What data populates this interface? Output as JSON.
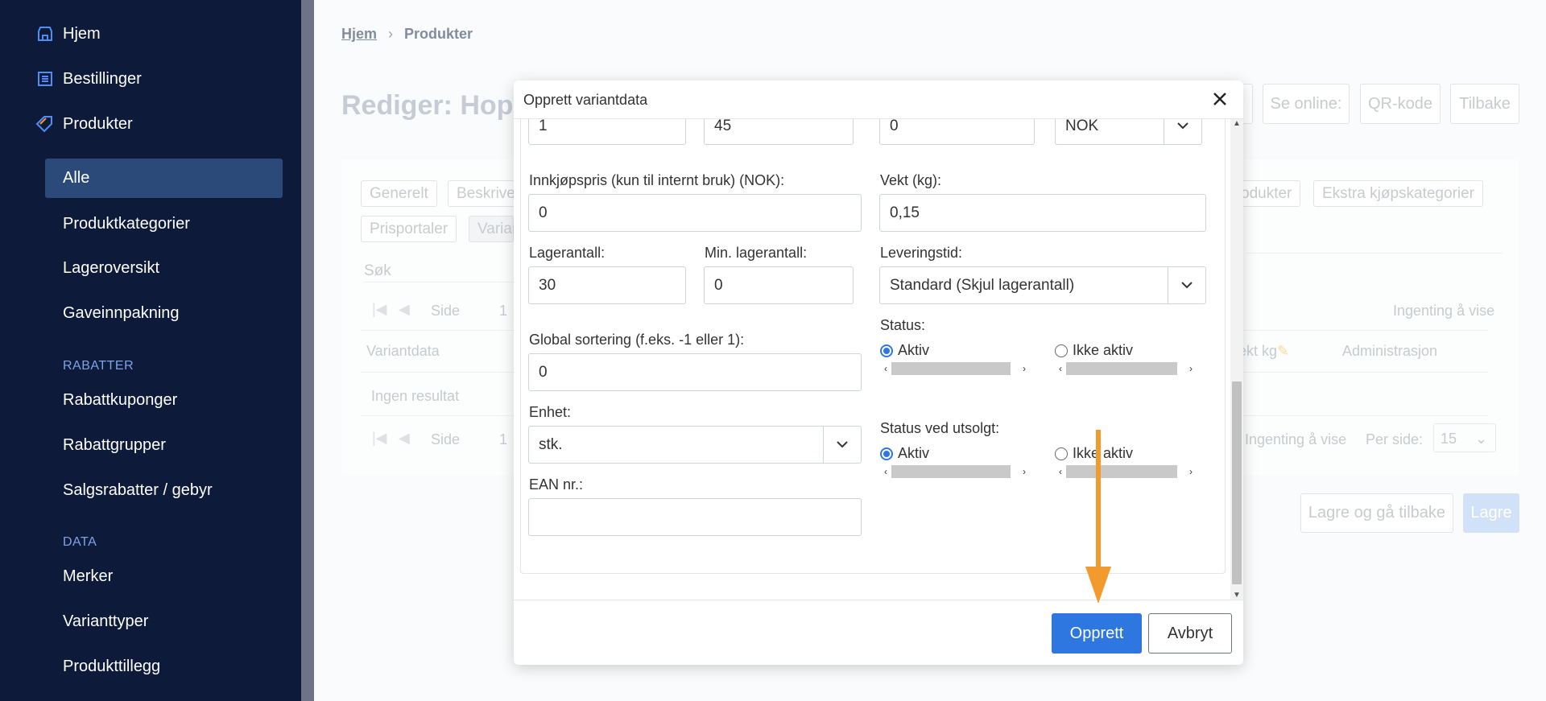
{
  "sidebar": {
    "top_items": [
      {
        "label": "Hjem",
        "icon": "store-icon"
      },
      {
        "label": "Bestillinger",
        "icon": "list-icon"
      },
      {
        "label": "Produkter",
        "icon": "tag-icon"
      }
    ],
    "produkter_sub": [
      "Alle",
      "Produktkategorier",
      "Lageroversikt",
      "Gaveinnpakning"
    ],
    "rabatter_header": "RABATTER",
    "rabatter_items": [
      "Rabattkuponger",
      "Rabattgrupper",
      "Salgsrabatter / gebyr"
    ],
    "data_header": "DATA",
    "data_items": [
      "Merker",
      "Varianttyper",
      "Produkttillegg"
    ]
  },
  "breadcrumb": {
    "home": "Hjem",
    "current": "Produkter"
  },
  "page": {
    "title": "Rediger: Hopp",
    "top_buttons": [
      "Se online:",
      "QR-kode",
      "Tilbake"
    ],
    "tabs_row1": [
      "Generelt",
      "Beskrive",
      "odukter",
      "Ekstra kjøpskategorier"
    ],
    "tabs_row2": [
      "Prisportaler",
      "Varian"
    ],
    "search_placeholder": "Søk",
    "pager_side": "Side",
    "pager_page": "1",
    "nothing_to_show": "Ingenting å vise",
    "col_variantdata": "Variantdata",
    "col_vekt": "ekt kg",
    "col_admin": "Administrasjon",
    "no_results": "Ingen resultat",
    "per_page_label": "Per side:",
    "per_page_value": "15",
    "save_back": "Lagre og gå tilbake",
    "save": "Lagre"
  },
  "modal": {
    "title": "Opprett variantdata",
    "top_row": {
      "v1": "1",
      "v2": "45",
      "v3": "0",
      "currency": "NOK"
    },
    "purchase_price_label": "Innkjøpspris (kun til internt bruk) (NOK):",
    "purchase_price": "0",
    "weight_label": "Vekt (kg):",
    "weight": "0,15",
    "stock_label": "Lagerantall:",
    "stock": "30",
    "min_stock_label": "Min. lagerantall:",
    "min_stock": "0",
    "delivery_label": "Leveringstid:",
    "delivery": "Standard (Skjul lagerantall)",
    "status_label": "Status:",
    "status_active": "Aktiv",
    "status_inactive": "Ikke aktiv",
    "sort_label": "Global sortering (f.eks. -1 eller 1):",
    "sort": "0",
    "unit_label": "Enhet:",
    "unit": "stk.",
    "soldout_label": "Status ved utsolgt:",
    "soldout_active": "Aktiv",
    "soldout_inactive": "Ikke aktiv",
    "ean_label": "EAN nr.:",
    "ean": "",
    "create": "Opprett",
    "cancel": "Avbryt"
  },
  "colors": {
    "sidebar": "#0e1a3a",
    "primary": "#2f77e0",
    "annotation": "#f39a2f",
    "accent_icon": "#4f8ef7"
  }
}
